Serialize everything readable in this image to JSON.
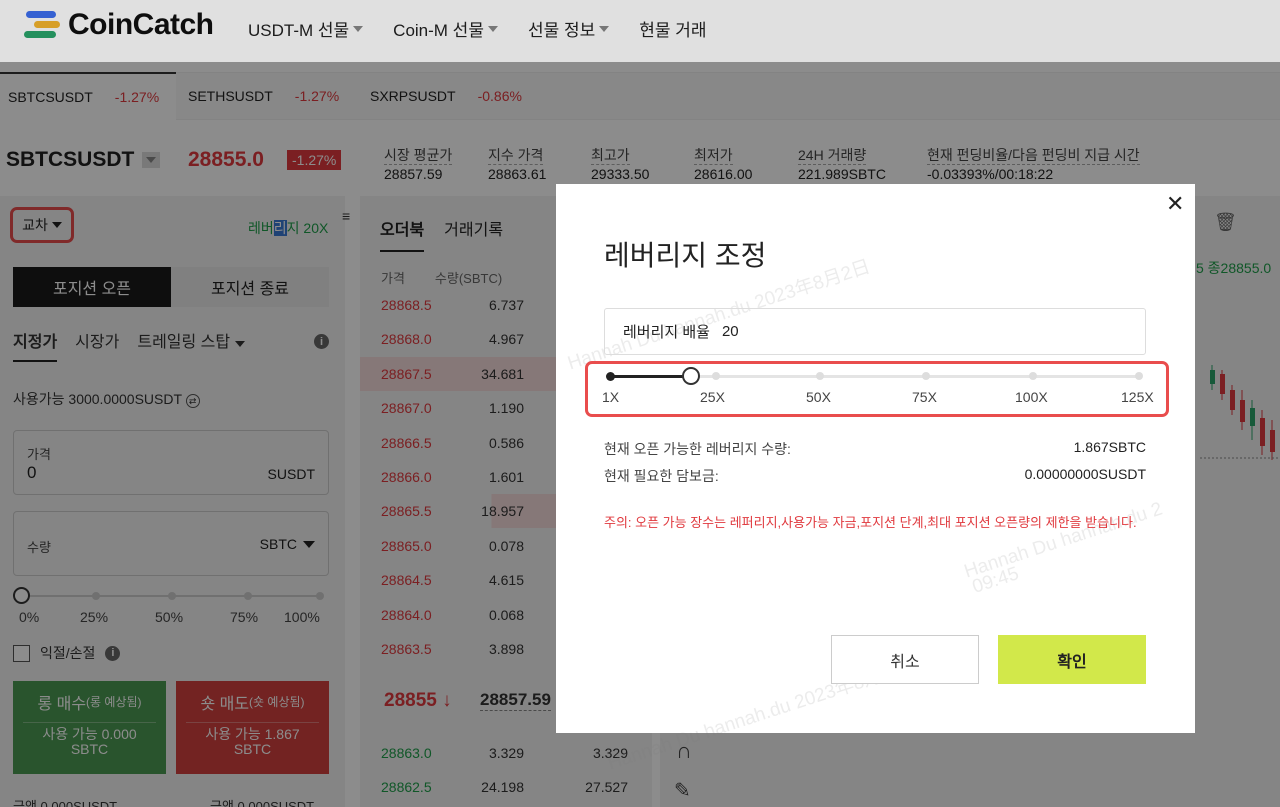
{
  "header": {
    "brand": "CoinCatch",
    "nav": [
      "USDT-M 선물",
      "Coin-M 선물",
      "선물 정보",
      "현물 거래"
    ]
  },
  "tickers": [
    {
      "symbol": "SBTCSUSDT",
      "change": "-1.27%"
    },
    {
      "symbol": "SETHSUSDT",
      "change": "-1.27%"
    },
    {
      "symbol": "SXRPSUSDT",
      "change": "-0.86%"
    }
  ],
  "symbol": {
    "name": "SBTCSUSDT",
    "price": "28855.0",
    "change": "-1.27%",
    "stats": [
      {
        "label": "시장 평균가",
        "value": "28857.59"
      },
      {
        "label": "지수 가격",
        "value": "28863.61"
      },
      {
        "label": "최고가",
        "value": "29333.50"
      },
      {
        "label": "최저가",
        "value": "28616.00"
      },
      {
        "label": "24H 거래량",
        "value": "221.989SBTC"
      },
      {
        "label": "현재 펀딩비율/다음 펀딩비 지급 시간",
        "value": "-0.03393%/00:18:22"
      }
    ]
  },
  "left": {
    "margin_mode": "교차",
    "leverage_tag_pre": "레버",
    "leverage_tag_hl": "리",
    "leverage_tag_post": "지 20X",
    "open_tab": "포지션 오픈",
    "close_tab": "포지션 종료",
    "order_types": [
      "지정가",
      "시장가",
      "트레일링 스탑"
    ],
    "available": "사용가능 3000.0000SUSDT",
    "price_label": "가격",
    "price_value": "0",
    "price_unit": "SUSDT",
    "qty_label": "수량",
    "qty_unit": "SBTC",
    "pct": [
      "0%",
      "25%",
      "50%",
      "75%",
      "100%"
    ],
    "tpsl": "익절/손절",
    "buy_title": "롱 매수",
    "buy_sub": "(롱 예상됨)",
    "buy_avail": "사용 가능 0.000",
    "buy_unit": "SBTC",
    "sell_title": "숏 매도",
    "sell_sub": "(숏 예상됨)",
    "sell_avail": "사용 가능 1.867",
    "sell_unit": "SBTC",
    "amount_buy": "금액 0.000SUSDT",
    "amount_sell": "금액 0.000SUSDT"
  },
  "orderbook": {
    "tabs": [
      "오더북",
      "거래기록"
    ],
    "headers": [
      "가격",
      "수량(SBTC)"
    ],
    "asks": [
      {
        "price": "28868.5",
        "qty": "6.737"
      },
      {
        "price": "28868.0",
        "qty": "4.967"
      },
      {
        "price": "28867.5",
        "qty": "34.681"
      },
      {
        "price": "28867.0",
        "qty": "1.190"
      },
      {
        "price": "28866.5",
        "qty": "0.586"
      },
      {
        "price": "28866.0",
        "qty": "1.601"
      },
      {
        "price": "28865.5",
        "qty": "18.957"
      },
      {
        "price": "28865.0",
        "qty": "0.078"
      },
      {
        "price": "28864.5",
        "qty": "4.615"
      },
      {
        "price": "28864.0",
        "qty": "0.068"
      },
      {
        "price": "28863.5",
        "qty": "3.898"
      }
    ],
    "last_price": "28855",
    "last_arrow": "↓",
    "mark_price": "28857.59",
    "bids": [
      {
        "price": "28863.0",
        "qty": "3.329",
        "total": "3.329"
      },
      {
        "price": "28862.5",
        "qty": "24.198",
        "total": "27.527"
      }
    ]
  },
  "chart": {
    "partial_text": "5  종28855.0"
  },
  "modal": {
    "title": "레버리지 조정",
    "input_label": "레버리지 배율",
    "input_value": "20",
    "slider_labels": [
      "1X",
      "25X",
      "50X",
      "75X",
      "100X",
      "125X"
    ],
    "slider_value": 20,
    "slider_min": 1,
    "slider_max": 125,
    "rows": [
      {
        "label": "현재 오픈 가능한 레버리지 수량:",
        "value": "1.867SBTC"
      },
      {
        "label": "현재 필요한 담보금:",
        "value": "0.00000000SUSDT"
      }
    ],
    "warning": "주의: 오픈 가능 장수는 레퍼리지,사용가능 자금,포지션 단계,최대 포지션 오픈량의 제한을 받습니다.",
    "cancel": "취소",
    "confirm": "확인",
    "close_glyph": "✕"
  },
  "watermark": {
    "line1": "Hannah Du hannah.du 2023年8月2日",
    "line2": "Hannah Du hannah.du 2",
    "line3": "09:45"
  },
  "colors": {
    "negative": "#e0393e",
    "positive": "#1e9e4a",
    "confirm": "#d2e84a",
    "highlight_border": "#e94d4d"
  }
}
